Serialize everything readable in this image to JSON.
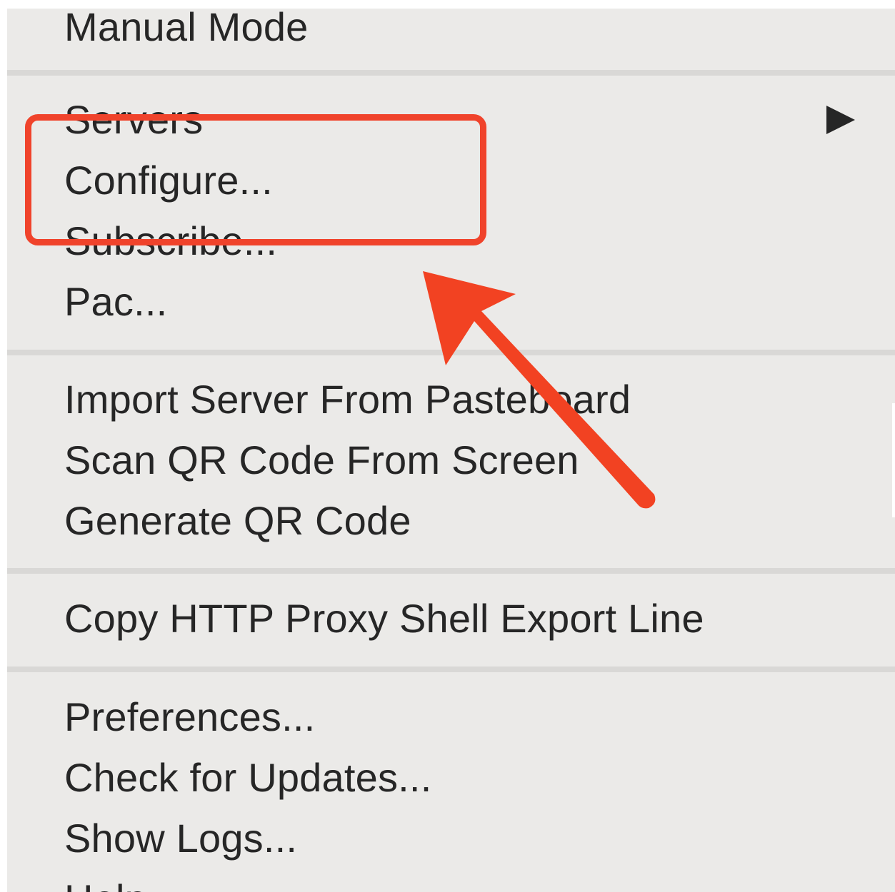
{
  "menu": {
    "groups": [
      {
        "items": [
          {
            "label": "Manual Mode"
          }
        ]
      },
      {
        "items": [
          {
            "label": "Servers",
            "has_submenu": true
          },
          {
            "label": "Configure..."
          },
          {
            "label": "Subscribe..."
          },
          {
            "label": "Pac..."
          }
        ]
      },
      {
        "items": [
          {
            "label": "Import Server From Pasteboard"
          },
          {
            "label": "Scan QR Code From Screen"
          },
          {
            "label": "Generate QR Code"
          }
        ]
      },
      {
        "items": [
          {
            "label": "Copy HTTP Proxy Shell Export Line"
          }
        ]
      },
      {
        "items": [
          {
            "label": "Preferences..."
          },
          {
            "label": "Check for Updates..."
          },
          {
            "label": "Show Logs..."
          },
          {
            "label": "Help"
          }
        ]
      }
    ],
    "submenu_icon": "triangle-right-icon"
  },
  "annotation": {
    "highlight_color": "#f0432b",
    "arrow_color": "#f24222",
    "arrow_icon": "annotation-arrow-icon"
  }
}
